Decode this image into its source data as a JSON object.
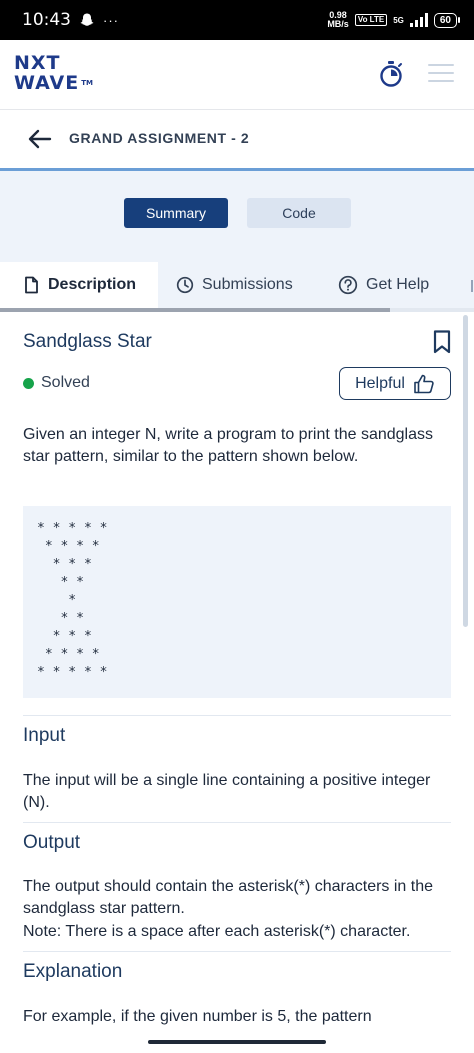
{
  "status_bar": {
    "time": "10:43",
    "dots": "···",
    "speed_top": "0.98",
    "speed_bottom": "MB/s",
    "volte": "Vo LTE",
    "network": "5G",
    "battery": "60"
  },
  "header": {
    "logo_line1": "NXT",
    "logo_line2": "WAVE",
    "logo_tm": "TM"
  },
  "title_bar": {
    "title": "GRAND ASSIGNMENT - 2"
  },
  "toggle": {
    "summary_label": "Summary",
    "code_label": "Code",
    "active_color": "#173f7c"
  },
  "tabs": [
    {
      "label": "Description",
      "icon": "document-icon",
      "active": true
    },
    {
      "label": "Submissions",
      "icon": "clock-icon",
      "active": false
    },
    {
      "label": "Get Help",
      "icon": "question-icon",
      "active": false
    }
  ],
  "problem": {
    "title": "Sandglass Star",
    "status": "Solved",
    "status_color": "#16a34a",
    "helpful_label": "Helpful",
    "statement": "Given an integer N, write a program to print the sandglass star pattern, similar to the pattern shown below.",
    "pattern_lines": [
      "* * * * *",
      " * * * *",
      "  * * *",
      "   * *",
      "    *",
      "   * *",
      "  * * *",
      " * * * *",
      "* * * * *"
    ]
  },
  "sections": {
    "input_heading": "Input",
    "input_text": "The input will be a single line containing a positive integer (N).",
    "output_heading": "Output",
    "output_text": "The output should contain the asterisk(*) characters in the sandglass star pattern.",
    "output_note": "Note: There is a space after each asterisk(*) character.",
    "explanation_heading": "Explanation",
    "explanation_text": "For example, if the given number is 5, the pattern"
  }
}
